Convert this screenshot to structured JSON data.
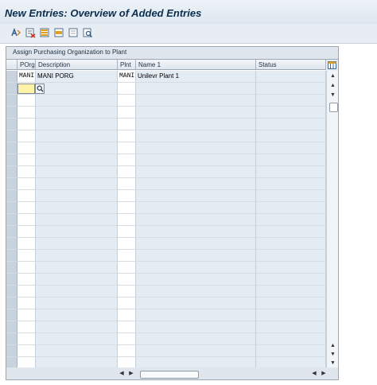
{
  "window": {
    "title": "New Entries: Overview of Added Entries"
  },
  "toolbar": {
    "buttons": [
      {
        "name": "change-display-icon"
      },
      {
        "name": "delete-icon"
      },
      {
        "name": "select-all-icon"
      },
      {
        "name": "select-block-icon"
      },
      {
        "name": "deselect-all-icon"
      },
      {
        "name": "find-icon"
      }
    ]
  },
  "panel": {
    "title": "Assign Purchasing Organization to Plant"
  },
  "table": {
    "columns": [
      {
        "key": "porg",
        "label": "POrg"
      },
      {
        "key": "description",
        "label": "Description"
      },
      {
        "key": "plnt",
        "label": "Plnt"
      },
      {
        "key": "name1",
        "label": "Name 1"
      },
      {
        "key": "status",
        "label": "Status"
      }
    ],
    "rows": [
      {
        "porg": "MANI",
        "description": "MANI PORG",
        "plnt": "MANI",
        "name1": "Unilevr Plant 1",
        "status": ""
      }
    ]
  },
  "colors": {
    "accent": "#0b2e4f",
    "active_input": "#fff3a8",
    "grid_header": "#dfe6ee",
    "alt_column": "#e3ebf3"
  }
}
